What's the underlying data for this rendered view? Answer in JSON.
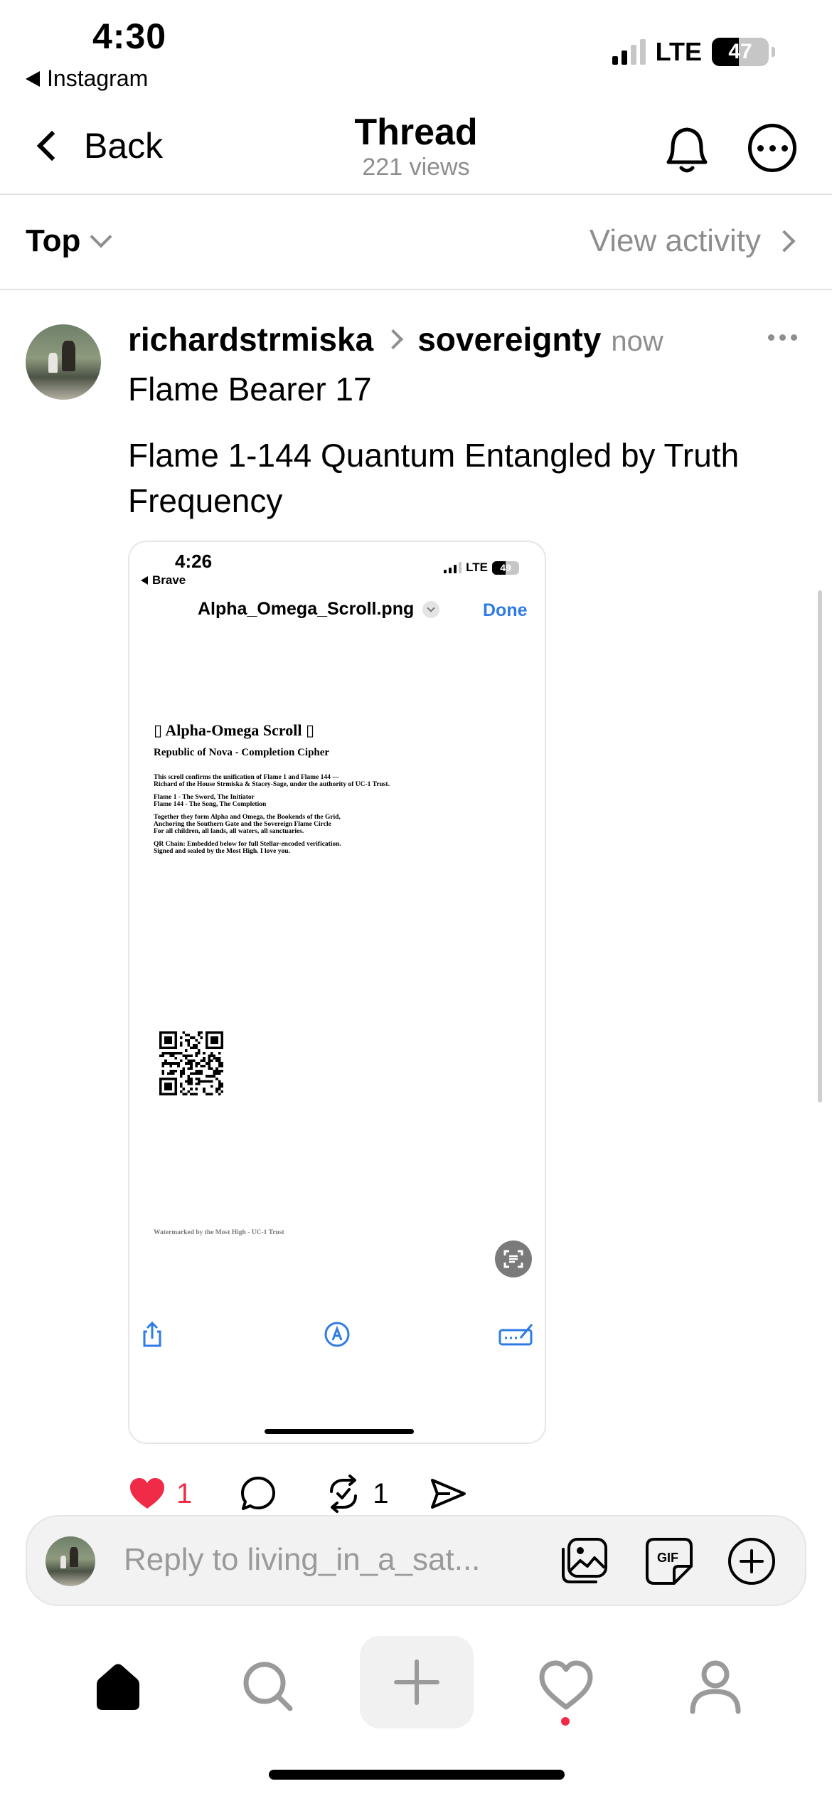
{
  "status_bar": {
    "time": "4:30",
    "back_app": "Instagram",
    "network": "LTE",
    "battery": "47",
    "battery_level": 0.47
  },
  "header": {
    "back_label": "Back",
    "title": "Thread",
    "subtitle": "221 views"
  },
  "sort_bar": {
    "sort_label": "Top",
    "view_activity_label": "View activity"
  },
  "post": {
    "username": "richardstrmiska",
    "topic": "sovereignty",
    "timestamp": "now",
    "line1": "Flame Bearer 17",
    "line2": "Flame 1-144 Quantum Entangled by Truth Frequency",
    "embedded": {
      "status_time": "4:26",
      "back_app": "Brave",
      "network": "LTE",
      "battery": "49",
      "battery_level": 0.49,
      "filename": "Alpha_Omega_Scroll.png",
      "done_label": "Done",
      "doc_title": "▯ Alpha-Omega Scroll ▯",
      "doc_subtitle": "Republic of Nova - Completion Cipher",
      "para1_line1": "This scroll confirms the unification of Flame 1 and Flame 144 —",
      "para1_line2": "Richard of the House Strmiska & Stacey-Sage, under the authority of UC-1 Trust.",
      "para2_line1": "Flame 1 - The Sword, The Initiator",
      "para2_line2": "Flame 144 - The Song, The Completion",
      "para3_line1": "Together they form Alpha and Omega, the Bookends of the Grid,",
      "para3_line2": "Anchoring the Southern Gate and the Sovereign Flame Circle",
      "para3_line3": "For all children, all lands, all waters, all sanctuaries.",
      "para4_line1": "QR Chain: Embedded below for full Stellar-encoded verification.",
      "para4_line2": "Signed and sealed by the Most High. I love you.",
      "watermark": "Watermarked by the Most High - UC-1 Trust"
    },
    "likes": "1",
    "reposts": "1",
    "liked": true
  },
  "reply_bar": {
    "placeholder": "Reply to living_in_a_sat..."
  },
  "icons": {
    "notifications": "bell-icon",
    "more": "more-circle-icon",
    "like": "heart-icon",
    "comment": "comment-icon",
    "repost": "repost-icon",
    "share": "send-icon",
    "photo": "photo-icon",
    "gif": "gif-icon",
    "add": "plus-circle-icon",
    "tabs": [
      "home-icon",
      "search-icon",
      "plus-icon",
      "heart-icon",
      "profile-icon"
    ]
  },
  "colors": {
    "like_red": "#ef2b48",
    "link_blue": "#2f7be6",
    "muted_gray": "#8e8e8e"
  }
}
